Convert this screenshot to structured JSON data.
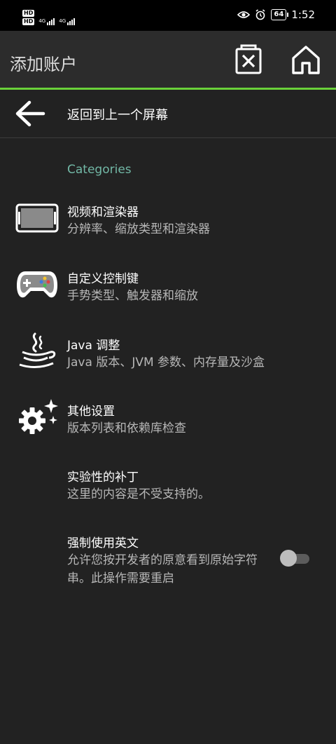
{
  "status_bar": {
    "time": "1:52",
    "battery": "64",
    "sim1_badge": "HD",
    "sim2_badge": "HD",
    "network1": "4G",
    "network2": "4G"
  },
  "app_bar": {
    "title": "添加账户",
    "actions": [
      "delete-icon",
      "home-icon"
    ]
  },
  "back": {
    "label": "返回到上一个屏幕"
  },
  "category": {
    "header": "Categories"
  },
  "preferences": [
    {
      "icon": "video-renderer-icon",
      "title": "视频和渲染器",
      "summary": "分辨率、缩放类型和渲染器"
    },
    {
      "icon": "gamepad-icon",
      "title": "自定义控制键",
      "summary": "手势类型、触发器和缩放"
    },
    {
      "icon": "java-icon",
      "title": "Java 调整",
      "summary": "Java 版本、JVM 参数、内存量及沙盒"
    },
    {
      "icon": "settings-sparkle-icon",
      "title": "其他设置",
      "summary": "版本列表和依赖库检查"
    },
    {
      "icon": "",
      "title": "实验性的补丁",
      "summary": "这里的内容是不受支持的。"
    },
    {
      "icon": "",
      "title": "强制使用英文",
      "summary": "允许您按开发者的原意看到原始字符串。此操作需要重启",
      "switch_on": false
    }
  ],
  "colors": {
    "accent_green": "#6ad13a",
    "category_teal": "#72b8a6",
    "background": "#222222"
  }
}
